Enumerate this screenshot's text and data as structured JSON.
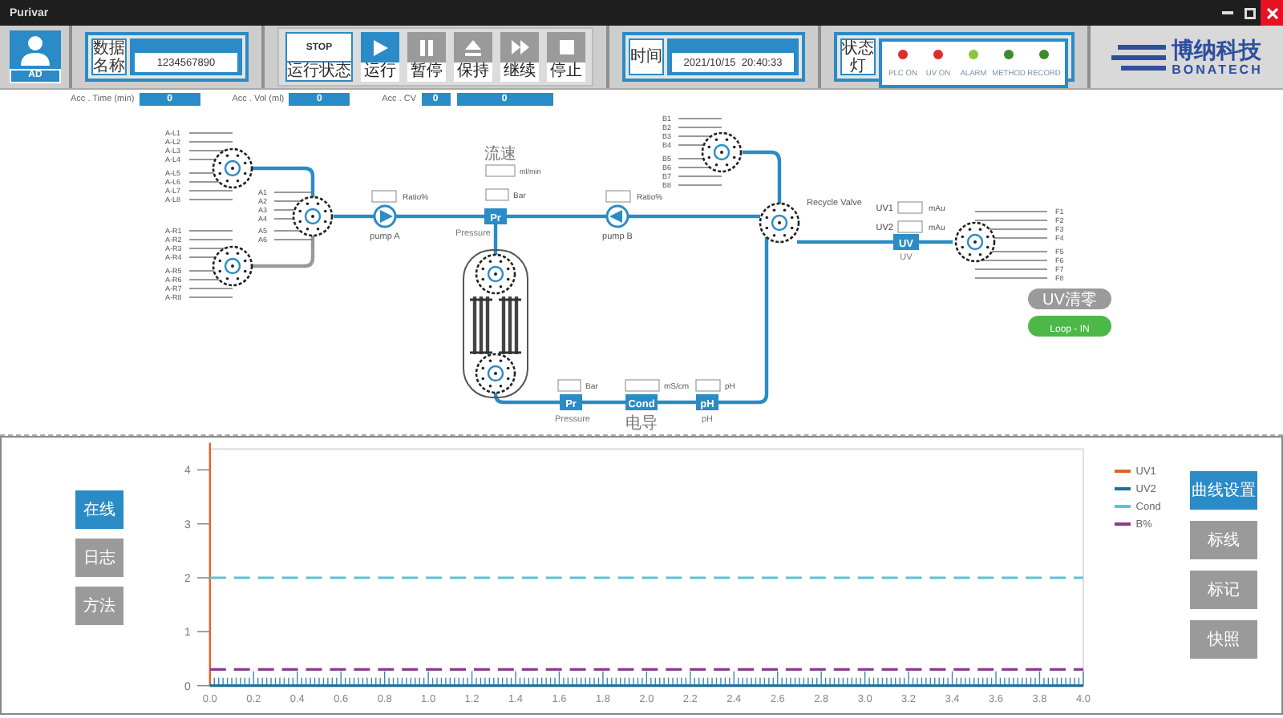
{
  "window": {
    "title": "Purivar"
  },
  "user": {
    "name": "AD"
  },
  "data_name": {
    "label": "数据名称",
    "value": "1234567890"
  },
  "run_state": {
    "status": "STOP",
    "label": "运行状态"
  },
  "run_buttons": [
    {
      "label": "运行",
      "kind": "play",
      "selected": true
    },
    {
      "label": "暂停",
      "kind": "pause",
      "selected": false
    },
    {
      "label": "保持",
      "kind": "eject",
      "selected": false
    },
    {
      "label": "继续",
      "kind": "forward",
      "selected": false
    },
    {
      "label": "停止",
      "kind": "stop",
      "selected": false
    }
  ],
  "time": {
    "label": "时间",
    "value": "2021/10/15  20:40:33"
  },
  "status_lights": {
    "label": "状态灯",
    "lights": [
      {
        "label": "PLC ON",
        "color": "#e02b2b"
      },
      {
        "label": "UV ON",
        "color": "#e02b2b"
      },
      {
        "label": "ALARM",
        "color": "#8cc63f"
      },
      {
        "label": "METHOD",
        "color": "#3d8b2f"
      },
      {
        "label": "RECORD",
        "color": "#3d8b2f"
      }
    ]
  },
  "logo": {
    "name": "博纳科技",
    "subtitle": "BONATECH"
  },
  "accumulators": [
    {
      "label": "Acc . Time (min)",
      "values": [
        "0"
      ]
    },
    {
      "label": "Acc . Vol (ml)",
      "values": [
        "0"
      ]
    },
    {
      "label": "Acc . CV",
      "values": [
        "0",
        "0"
      ]
    }
  ],
  "diagram": {
    "port_groups": [
      {
        "ports": [
          "A-L1",
          "A-L2",
          "A-L3",
          "A-L4",
          "A-L5",
          "A-L6",
          "A-L7",
          "A-L8"
        ]
      },
      {
        "ports": [
          "A-R1",
          "A-R2",
          "A-R3",
          "A-R4",
          "A-R5",
          "A-R6",
          "A-R7",
          "A-R8"
        ]
      },
      {
        "ports": [
          "A1",
          "A2",
          "A3",
          "A4",
          "A5",
          "A6"
        ]
      },
      {
        "ports": [
          "B1",
          "B2",
          "B3",
          "B4",
          "B5",
          "B6",
          "B7",
          "B8"
        ]
      },
      {
        "ports": [
          "F1",
          "F2",
          "F3",
          "F4",
          "F5",
          "F6",
          "F7",
          "F8"
        ]
      }
    ],
    "pumps": [
      {
        "label": "pump A",
        "unit": "Ratio%"
      },
      {
        "label": "pump B",
        "unit": "Ratio%"
      }
    ],
    "flow": {
      "caption": "流速",
      "unit": "ml/min"
    },
    "sensors": [
      {
        "tag": "Pr",
        "unit": "Bar",
        "caption": "Pressure"
      },
      {
        "tag": "Pr",
        "unit": "Bar",
        "caption": "Pressure"
      },
      {
        "tag": "Cond",
        "unit": "mS/cm",
        "caption": "电导"
      },
      {
        "tag": "pH",
        "unit": "pH",
        "caption": "pH"
      },
      {
        "tag": "UV",
        "caption": "UV"
      }
    ],
    "recycle_valve": {
      "label": "Recycle Valve"
    },
    "uv_readings": [
      {
        "label": "UV1",
        "unit": "mAu"
      },
      {
        "label": "UV2",
        "unit": "mAu"
      }
    ],
    "buttons": [
      {
        "label": "UV清零",
        "on": false
      },
      {
        "label": "Loop - IN",
        "on": true
      }
    ]
  },
  "view_tabs": [
    {
      "label": "在线",
      "selected": true
    },
    {
      "label": "日志",
      "selected": false
    },
    {
      "label": "方法",
      "selected": false
    }
  ],
  "chart": {
    "chart_data": {
      "type": "line",
      "x": [
        0,
        4
      ],
      "xlim": [
        0,
        4
      ],
      "ylim": [
        0,
        4.4
      ],
      "series": [
        {
          "name": "UV1",
          "color": "#e0622a",
          "values": [
            null,
            null
          ]
        },
        {
          "name": "UV2",
          "color": "#1f6f9a",
          "line_style": "solid",
          "values": [
            0,
            0
          ]
        },
        {
          "name": "Cond",
          "color": "#5cc3d6",
          "line_style": "dashed",
          "values": [
            2,
            2
          ]
        },
        {
          "name": "B%",
          "color": "#8a3b8f",
          "line_style": "dashed",
          "values": [
            0.3,
            0.3
          ]
        }
      ],
      "xticks": [
        {
          "value": 0,
          "label": "0.0"
        },
        {
          "value": 0.2,
          "label": "0.2"
        },
        {
          "value": 0.4,
          "label": "0.4"
        },
        {
          "value": 0.6,
          "label": "0.6"
        },
        {
          "value": 0.8,
          "label": "0.8"
        },
        {
          "value": 1,
          "label": "1.0"
        },
        {
          "value": 1.2,
          "label": "1.2"
        },
        {
          "value": 1.4,
          "label": "1.4"
        },
        {
          "value": 1.6,
          "label": "1.6"
        },
        {
          "value": 1.8,
          "label": "1.8"
        },
        {
          "value": 2,
          "label": "2.0"
        },
        {
          "value": 2.2,
          "label": "2.2"
        },
        {
          "value": 2.4,
          "label": "2.4"
        },
        {
          "value": 2.6,
          "label": "2.6"
        },
        {
          "value": 2.8,
          "label": "2.8"
        },
        {
          "value": 3,
          "label": "3.0"
        },
        {
          "value": 3.2,
          "label": "3.2"
        },
        {
          "value": 3.4,
          "label": "3.4"
        },
        {
          "value": 3.6,
          "label": "3.6"
        },
        {
          "value": 3.8,
          "label": "3.8"
        },
        {
          "value": 4,
          "label": "4.0"
        }
      ],
      "yticks": [
        0,
        1,
        2,
        3,
        4
      ]
    }
  },
  "chart_tools": [
    {
      "label": "曲线设置",
      "selected": true
    },
    {
      "label": "标线",
      "selected": false
    },
    {
      "label": "标记",
      "selected": false
    },
    {
      "label": "快照",
      "selected": false
    }
  ]
}
